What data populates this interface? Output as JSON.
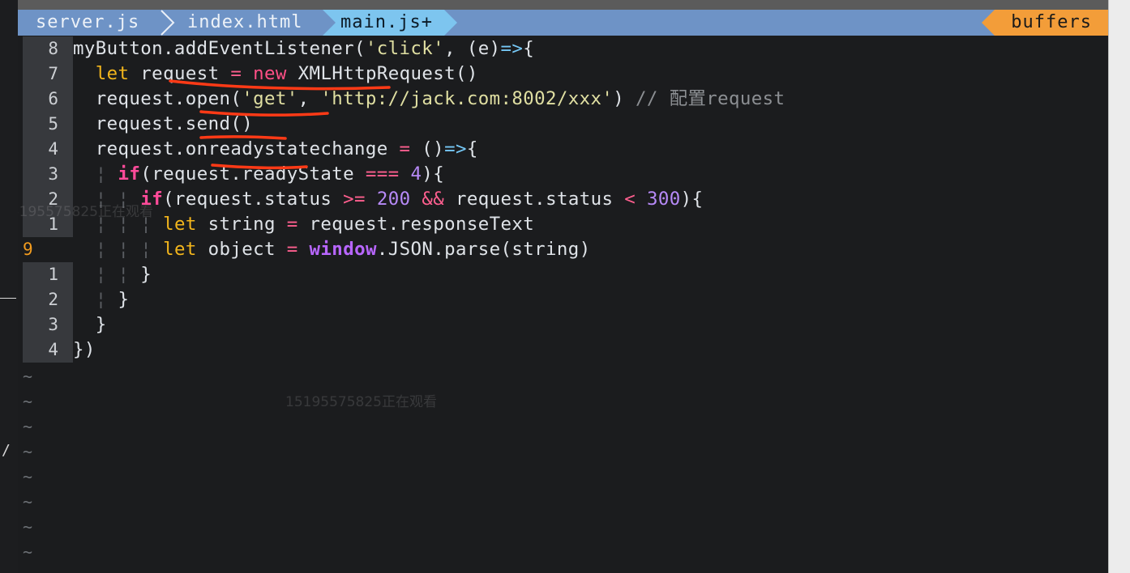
{
  "tabs": [
    {
      "label": "server.js"
    },
    {
      "label": "index.html"
    },
    {
      "label": "main.js+"
    }
  ],
  "buffers_label": "buffers",
  "code_lines": {
    "l1": {
      "num": "8",
      "text": "myButton.addEventListener('click', (e)=>{"
    },
    "l2": {
      "num": "7",
      "text": "let request = new XMLHttpRequest()"
    },
    "l3": {
      "num": "6",
      "text": "request.open('get', 'http://jack.com:8002/xxx') // 配置request"
    },
    "l4": {
      "num": "5",
      "text": "request.send()"
    },
    "l5": {
      "num": "4",
      "text": "request.onreadystatechange = ()=>{"
    },
    "l6": {
      "num": "3",
      "text": "if(request.readyState === 4){"
    },
    "l7": {
      "num": "2",
      "text": "if(request.status >= 200 && request.status < 300){"
    },
    "l8": {
      "num": "1",
      "text": "let string = request.responseText"
    },
    "l9": {
      "num": "9",
      "text": "let object = window.JSON.parse(string)"
    },
    "l10": {
      "num": "1",
      "text": "}"
    },
    "l11": {
      "num": "2",
      "text": "}"
    },
    "l12": {
      "num": "3",
      "text": "}"
    },
    "l13": {
      "num": "4",
      "text": "})"
    }
  },
  "empty_line_marker": "~",
  "watermark": "15195575825正在观看",
  "left_slash": "/",
  "colors": {
    "tabline": "#6e93c6",
    "active_tab": "#7dc5ef",
    "buffers": "#f39d39",
    "keyword": "#f2b51c",
    "if_keyword": "#ff4b9a",
    "string": "#e0dfa2",
    "number": "#b78af8",
    "current_line_number": "#f39c1e",
    "annotation_underline": "#ff3a16"
  }
}
